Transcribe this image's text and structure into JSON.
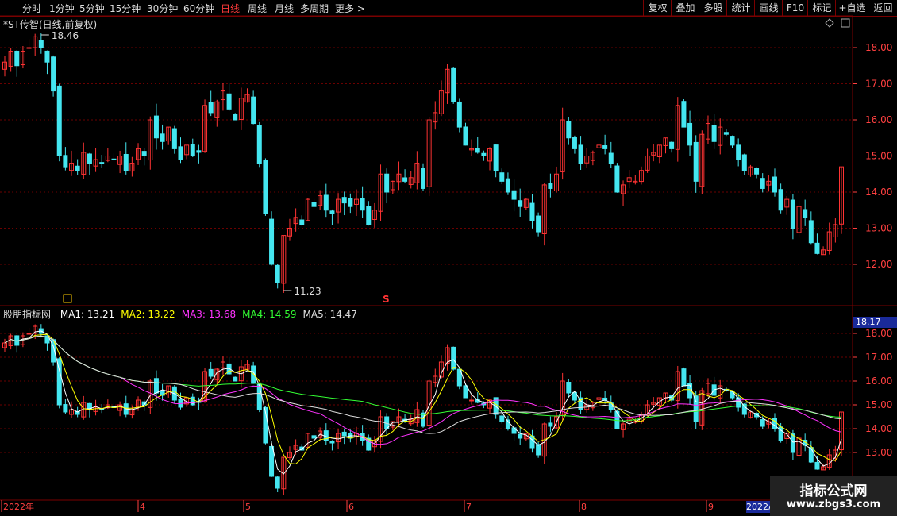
{
  "toolbar": {
    "periods": [
      "分时",
      "1分钟",
      "5分钟",
      "15分钟",
      "30分钟",
      "60分钟",
      "日线",
      "周线",
      "月线",
      "多周期",
      "更多 >"
    ],
    "active": "日线",
    "right_buttons": [
      "复权",
      "叠加",
      "多股",
      "统计",
      "画线",
      "F10",
      "标记",
      "+自选",
      "返回"
    ]
  },
  "price_panel": {
    "title": "*ST传智(日线,前复权)",
    "high_label": "18.46",
    "low_label": "11.23",
    "marker_s": "S",
    "y_ticks": [
      "18.00",
      "17.00",
      "16.00",
      "15.00",
      "14.00",
      "13.00",
      "12.00"
    ]
  },
  "indicator_panel": {
    "name": "股朋指标网",
    "ma": [
      {
        "label": "MA1: 13.21",
        "color": "#ffffff"
      },
      {
        "label": "MA2: 13.22",
        "color": "#ffff00"
      },
      {
        "label": "MA3: 13.68",
        "color": "#ff33ff"
      },
      {
        "label": "MA4: 14.59",
        "color": "#33ff33"
      },
      {
        "label": "MA5: 14.47",
        "color": "#dddddd"
      }
    ],
    "current_badge": "18.17",
    "y_ticks": [
      "18.00",
      "17.00",
      "16.00",
      "15.00",
      "14.00",
      "13.00"
    ]
  },
  "x_axis": {
    "labels": [
      "2022年",
      "4",
      "5",
      "6",
      "7",
      "8",
      "9"
    ],
    "current_date": "2022/09"
  },
  "watermark": {
    "line1": "指标公式网",
    "line2": "www.zbgs3.com"
  },
  "colors": {
    "up": "#ff3333",
    "down": "#44e6f0",
    "axis": "#ff4040",
    "grid": "#7a0000"
  },
  "chart_data": {
    "type": "candlestick",
    "y_range": [
      11.23,
      18.46
    ],
    "closes": [
      17.6,
      17.9,
      17.5,
      17.9,
      18.0,
      18.3,
      18.0,
      17.6,
      16.8,
      15.0,
      14.7,
      14.8,
      14.6,
      15.1,
      14.8,
      14.9,
      14.8,
      15.0,
      14.9,
      15.0,
      14.6,
      14.8,
      15.2,
      15.0,
      16.0,
      15.5,
      15.4,
      15.8,
      15.2,
      14.9,
      15.3,
      15.0,
      15.1,
      16.4,
      16.2,
      16.5,
      16.8,
      16.3,
      16.0,
      16.6,
      16.7,
      15.9,
      14.8,
      13.4,
      12.0,
      11.5,
      12.8,
      13.0,
      13.3,
      13.1,
      13.8,
      13.6,
      13.9,
      13.5,
      13.4,
      13.8,
      13.7,
      13.6,
      13.8,
      13.5,
      13.1,
      13.5,
      14.5,
      14.0,
      14.3,
      14.5,
      14.3,
      14.4,
      14.8,
      14.1,
      16.0,
      16.2,
      16.8,
      17.4,
      16.5,
      15.8,
      15.3,
      15.2,
      15.1,
      15.0,
      15.2,
      14.6,
      14.3,
      14.0,
      13.8,
      13.6,
      13.8,
      13.2,
      12.9,
      14.2,
      14.1,
      14.5,
      16.0,
      15.5,
      15.2,
      14.8,
      15.0,
      15.1,
      15.3,
      15.2,
      14.8,
      14.0,
      14.2,
      14.4,
      14.3,
      14.6,
      15.0,
      15.1,
      15.3,
      15.5,
      15.2,
      16.4,
      15.8,
      15.3,
      14.3,
      15.6,
      15.9,
      15.4,
      15.8,
      15.6,
      15.3,
      14.9,
      14.6,
      14.7,
      14.5,
      14.1,
      14.3,
      14.0,
      13.5,
      13.8,
      13.0,
      13.6,
      13.3,
      12.6,
      12.3,
      12.4,
      12.9,
      13.1,
      14.7
    ]
  }
}
